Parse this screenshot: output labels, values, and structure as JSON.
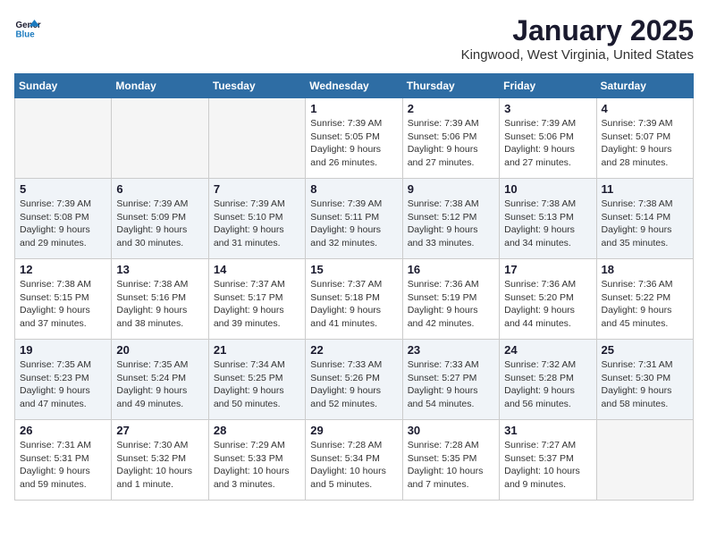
{
  "header": {
    "logo_line1": "General",
    "logo_line2": "Blue",
    "month": "January 2025",
    "location": "Kingwood, West Virginia, United States"
  },
  "weekdays": [
    "Sunday",
    "Monday",
    "Tuesday",
    "Wednesday",
    "Thursday",
    "Friday",
    "Saturday"
  ],
  "weeks": [
    [
      {
        "day": "",
        "info": ""
      },
      {
        "day": "",
        "info": ""
      },
      {
        "day": "",
        "info": ""
      },
      {
        "day": "1",
        "info": "Sunrise: 7:39 AM\nSunset: 5:05 PM\nDaylight: 9 hours\nand 26 minutes."
      },
      {
        "day": "2",
        "info": "Sunrise: 7:39 AM\nSunset: 5:06 PM\nDaylight: 9 hours\nand 27 minutes."
      },
      {
        "day": "3",
        "info": "Sunrise: 7:39 AM\nSunset: 5:06 PM\nDaylight: 9 hours\nand 27 minutes."
      },
      {
        "day": "4",
        "info": "Sunrise: 7:39 AM\nSunset: 5:07 PM\nDaylight: 9 hours\nand 28 minutes."
      }
    ],
    [
      {
        "day": "5",
        "info": "Sunrise: 7:39 AM\nSunset: 5:08 PM\nDaylight: 9 hours\nand 29 minutes."
      },
      {
        "day": "6",
        "info": "Sunrise: 7:39 AM\nSunset: 5:09 PM\nDaylight: 9 hours\nand 30 minutes."
      },
      {
        "day": "7",
        "info": "Sunrise: 7:39 AM\nSunset: 5:10 PM\nDaylight: 9 hours\nand 31 minutes."
      },
      {
        "day": "8",
        "info": "Sunrise: 7:39 AM\nSunset: 5:11 PM\nDaylight: 9 hours\nand 32 minutes."
      },
      {
        "day": "9",
        "info": "Sunrise: 7:38 AM\nSunset: 5:12 PM\nDaylight: 9 hours\nand 33 minutes."
      },
      {
        "day": "10",
        "info": "Sunrise: 7:38 AM\nSunset: 5:13 PM\nDaylight: 9 hours\nand 34 minutes."
      },
      {
        "day": "11",
        "info": "Sunrise: 7:38 AM\nSunset: 5:14 PM\nDaylight: 9 hours\nand 35 minutes."
      }
    ],
    [
      {
        "day": "12",
        "info": "Sunrise: 7:38 AM\nSunset: 5:15 PM\nDaylight: 9 hours\nand 37 minutes."
      },
      {
        "day": "13",
        "info": "Sunrise: 7:38 AM\nSunset: 5:16 PM\nDaylight: 9 hours\nand 38 minutes."
      },
      {
        "day": "14",
        "info": "Sunrise: 7:37 AM\nSunset: 5:17 PM\nDaylight: 9 hours\nand 39 minutes."
      },
      {
        "day": "15",
        "info": "Sunrise: 7:37 AM\nSunset: 5:18 PM\nDaylight: 9 hours\nand 41 minutes."
      },
      {
        "day": "16",
        "info": "Sunrise: 7:36 AM\nSunset: 5:19 PM\nDaylight: 9 hours\nand 42 minutes."
      },
      {
        "day": "17",
        "info": "Sunrise: 7:36 AM\nSunset: 5:20 PM\nDaylight: 9 hours\nand 44 minutes."
      },
      {
        "day": "18",
        "info": "Sunrise: 7:36 AM\nSunset: 5:22 PM\nDaylight: 9 hours\nand 45 minutes."
      }
    ],
    [
      {
        "day": "19",
        "info": "Sunrise: 7:35 AM\nSunset: 5:23 PM\nDaylight: 9 hours\nand 47 minutes."
      },
      {
        "day": "20",
        "info": "Sunrise: 7:35 AM\nSunset: 5:24 PM\nDaylight: 9 hours\nand 49 minutes."
      },
      {
        "day": "21",
        "info": "Sunrise: 7:34 AM\nSunset: 5:25 PM\nDaylight: 9 hours\nand 50 minutes."
      },
      {
        "day": "22",
        "info": "Sunrise: 7:33 AM\nSunset: 5:26 PM\nDaylight: 9 hours\nand 52 minutes."
      },
      {
        "day": "23",
        "info": "Sunrise: 7:33 AM\nSunset: 5:27 PM\nDaylight: 9 hours\nand 54 minutes."
      },
      {
        "day": "24",
        "info": "Sunrise: 7:32 AM\nSunset: 5:28 PM\nDaylight: 9 hours\nand 56 minutes."
      },
      {
        "day": "25",
        "info": "Sunrise: 7:31 AM\nSunset: 5:30 PM\nDaylight: 9 hours\nand 58 minutes."
      }
    ],
    [
      {
        "day": "26",
        "info": "Sunrise: 7:31 AM\nSunset: 5:31 PM\nDaylight: 9 hours\nand 59 minutes."
      },
      {
        "day": "27",
        "info": "Sunrise: 7:30 AM\nSunset: 5:32 PM\nDaylight: 10 hours\nand 1 minute."
      },
      {
        "day": "28",
        "info": "Sunrise: 7:29 AM\nSunset: 5:33 PM\nDaylight: 10 hours\nand 3 minutes."
      },
      {
        "day": "29",
        "info": "Sunrise: 7:28 AM\nSunset: 5:34 PM\nDaylight: 10 hours\nand 5 minutes."
      },
      {
        "day": "30",
        "info": "Sunrise: 7:28 AM\nSunset: 5:35 PM\nDaylight: 10 hours\nand 7 minutes."
      },
      {
        "day": "31",
        "info": "Sunrise: 7:27 AM\nSunset: 5:37 PM\nDaylight: 10 hours\nand 9 minutes."
      },
      {
        "day": "",
        "info": ""
      }
    ]
  ]
}
